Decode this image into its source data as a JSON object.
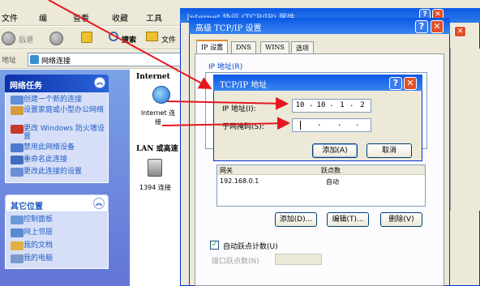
{
  "explorer": {
    "menus": [
      "文件",
      "编",
      "查看",
      "收藏",
      "工具"
    ],
    "back_label": "后退",
    "search_label": "搜索",
    "folders_label": "文件",
    "address_label": "地址",
    "address_value": "网络连接",
    "network_tasks": {
      "title": "网络任务",
      "items": [
        "创建一个新的连接",
        "设置家庭或小型办公网络",
        "更改 Windows 防火墙设置",
        "禁用此网络设备",
        "重命名此连接",
        "更改此连接的设置"
      ]
    },
    "other_places": {
      "title": "其它位置",
      "items": [
        "控制面板",
        "网上邻居",
        "我的文档",
        "我的电脑"
      ]
    },
    "content": {
      "internet_header": "Internet",
      "internet_item": "Internet 连接",
      "lan_header": "LAN 或高速",
      "lan_item": "1394 连接"
    }
  },
  "tcp_dialog": {
    "title": "Internet 协议 (TCP/IP) 属性"
  },
  "advanced_dialog": {
    "title": "高级 TCP/IP 设置",
    "tabs": [
      "IP 设置",
      "DNS",
      "WINS",
      "选项"
    ],
    "ip_group_label": "IP 地址(R)",
    "gateway_headers": [
      "网关",
      "跃点数"
    ],
    "gateway_row": [
      "192.168.0.1",
      "自动"
    ],
    "buttons": [
      "添加(D)...",
      "编辑(T)...",
      "删除(V)"
    ],
    "auto_metric_label": "自动跃点计数(U)",
    "interface_metric_label": "接口跃点数(N)"
  },
  "ip_dialog": {
    "title": "TCP/IP 地址",
    "ip_label": "IP 地址(I):",
    "ip_octets": [
      "10",
      "10",
      "1",
      "2"
    ],
    "mask_label": "子网掩码(S):",
    "add_button": "添加(A)",
    "cancel_button": "取消"
  },
  "colors": {
    "title_blue": "#0a58e6",
    "close_red": "#e0502b",
    "arrow_red": "#e5161f",
    "task_link": "#215dc6"
  }
}
